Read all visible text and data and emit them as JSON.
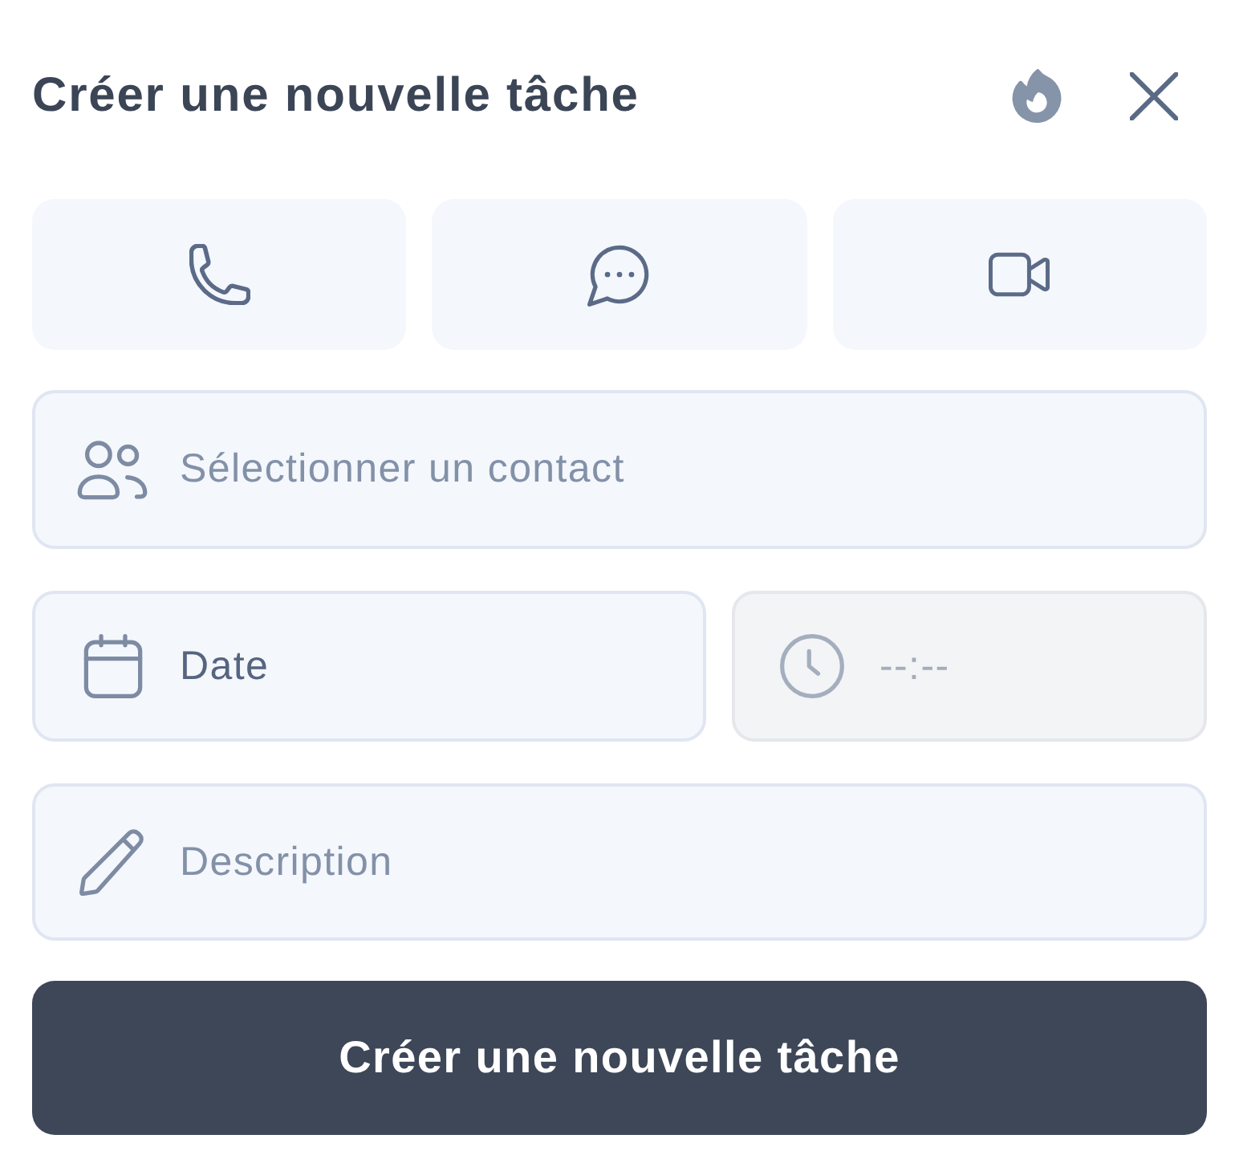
{
  "header": {
    "title": "Créer une nouvelle tâche"
  },
  "channels": [
    {
      "kind": "phone",
      "selected": false
    },
    {
      "kind": "chat",
      "selected": false
    },
    {
      "kind": "video",
      "selected": false
    }
  ],
  "contact_field": {
    "placeholder": "Sélectionner un contact"
  },
  "date_field": {
    "value": "Date"
  },
  "time_field": {
    "placeholder": "--:--",
    "disabled": true
  },
  "description_field": {
    "placeholder": "Description"
  },
  "submit_button": {
    "label": "Créer une nouvelle tâche"
  }
}
